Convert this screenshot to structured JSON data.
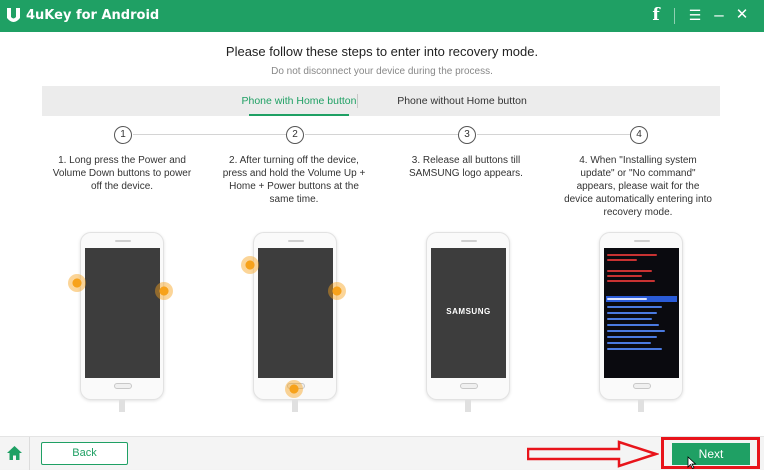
{
  "app": {
    "title": "4uKey for Android"
  },
  "window_controls": {
    "facebook": "f",
    "menu": "☰",
    "minimize": "–",
    "close": "✕"
  },
  "page": {
    "heading": "Please follow these steps to enter into recovery mode.",
    "subheading": "Do not disconnect your device during the process."
  },
  "tabs": [
    {
      "label": "Phone with Home button",
      "active": true
    },
    {
      "label": "Phone without Home button",
      "active": false
    }
  ],
  "steps": [
    {
      "number": "1",
      "text": "1. Long press the Power and Volume Down buttons to power off the device."
    },
    {
      "number": "2",
      "text": "2. After turning off the device, press and hold the Volume Up + Home + Power buttons at the same time."
    },
    {
      "number": "3",
      "text": "3. Release all buttons till SAMSUNG logo appears.",
      "screen_text": "SAMSUNG"
    },
    {
      "number": "4",
      "text": "4. When \"Installing system update\" or \"No command\" appears, please wait for the device automatically entering into recovery mode."
    }
  ],
  "footer": {
    "back_label": "Back",
    "next_label": "Next"
  },
  "colors": {
    "brand": "#1fa064",
    "highlight": "#e8141b",
    "glow": "#f7a21b",
    "recovery_selection": "#2a5bd7"
  },
  "icons": [
    "logo-icon",
    "facebook-icon",
    "menu-icon",
    "minimize-icon",
    "close-icon",
    "home-icon",
    "red-arrow-annotation"
  ]
}
